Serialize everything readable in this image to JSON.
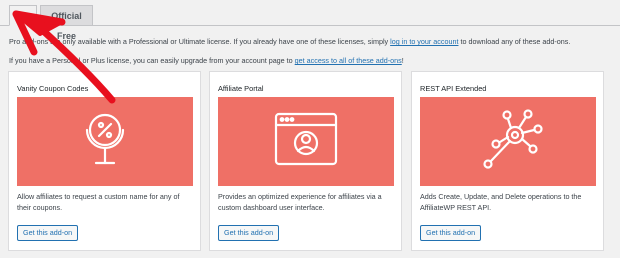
{
  "tabs": [
    {
      "label": "Pro",
      "active": true
    },
    {
      "label": "Official Free",
      "active": false
    }
  ],
  "intro": {
    "line1_prefix": "Pro add-ons are only available with a Professional or Ultimate license. If you already have one of these licenses, simply ",
    "line1_link": "log in to your account",
    "line1_suffix": " to download any of these add-ons.",
    "line2_prefix": "If you have a Personal or Plus license, you can easily upgrade from your account page to ",
    "line2_link": "get access to all of these add-ons",
    "line2_suffix": "!"
  },
  "addons": [
    {
      "title": "Vanity Coupon Codes",
      "icon": "coupon-mirror-icon",
      "description": "Allow affiliates to request a custom name for any of their coupons.",
      "button": "Get this add-on"
    },
    {
      "title": "Affiliate Portal",
      "icon": "browser-user-icon",
      "description": "Provides an optimized experience for affiliates via a custom dashboard user interface.",
      "button": "Get this add-on"
    },
    {
      "title": "REST API Extended",
      "icon": "network-nodes-icon",
      "description": "Adds Create, Update, and Delete operations to the AffiliateWP REST API.",
      "button": "Get this add-on"
    }
  ],
  "colors": {
    "banner": "#ef7066",
    "link": "#2271b1",
    "annotation_arrow": "#e8101e"
  }
}
